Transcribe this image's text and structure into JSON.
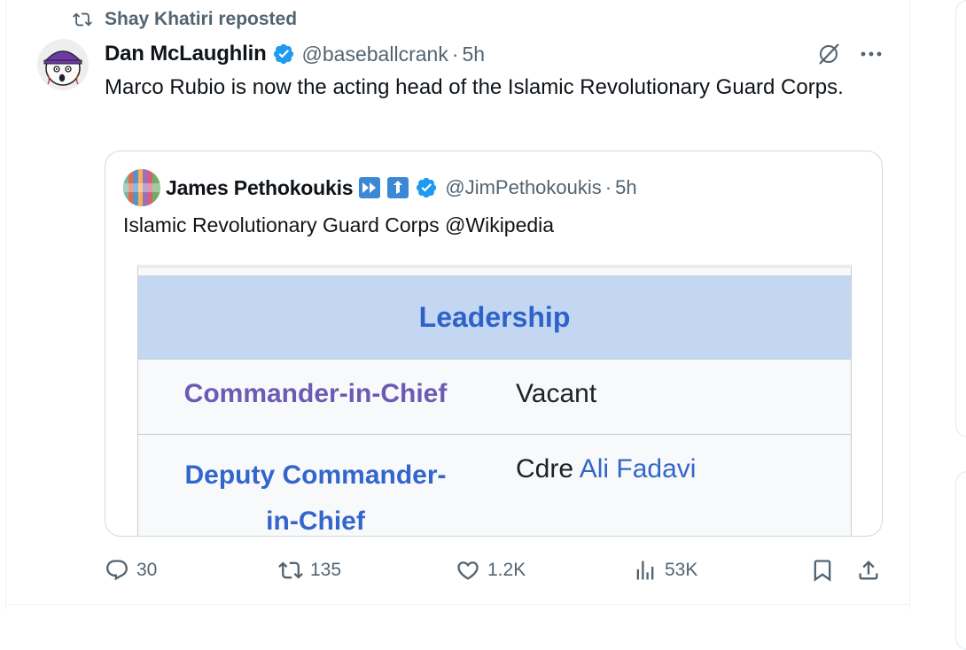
{
  "repost": {
    "text": "Shay Khatiri reposted",
    "icon": "repost-icon"
  },
  "tweet": {
    "author_name": "Dan McLaughlin",
    "verified": true,
    "handle": "@baseballcrank",
    "separator": "·",
    "time": "5h",
    "text": "Marco Rubio is now the acting head of the Islamic Revolutionary Guard Corps."
  },
  "quote": {
    "author_name": "James Pethokoukis",
    "handle": "@JimPethokoukis",
    "separator": "·",
    "time": "5h",
    "text": "Islamic Revolutionary Guard Corps @Wikipedia",
    "image": {
      "header": "Leadership",
      "rows": [
        {
          "label": "Commander-in-Chief",
          "value": "Vacant"
        },
        {
          "label_line1": "Deputy Commander-",
          "label_line2": "in-Chief",
          "value_prefix": "Cdre",
          "value_link": "Ali Fadavi"
        }
      ]
    }
  },
  "actions": {
    "replies": "30",
    "reposts": "135",
    "likes": "1.2K",
    "views": "53K"
  },
  "colors": {
    "accent": "#1d9bf0",
    "secondary_text": "#536471",
    "wiki_header_bg": "#c3d7f2",
    "wiki_link": "#3366cc"
  }
}
